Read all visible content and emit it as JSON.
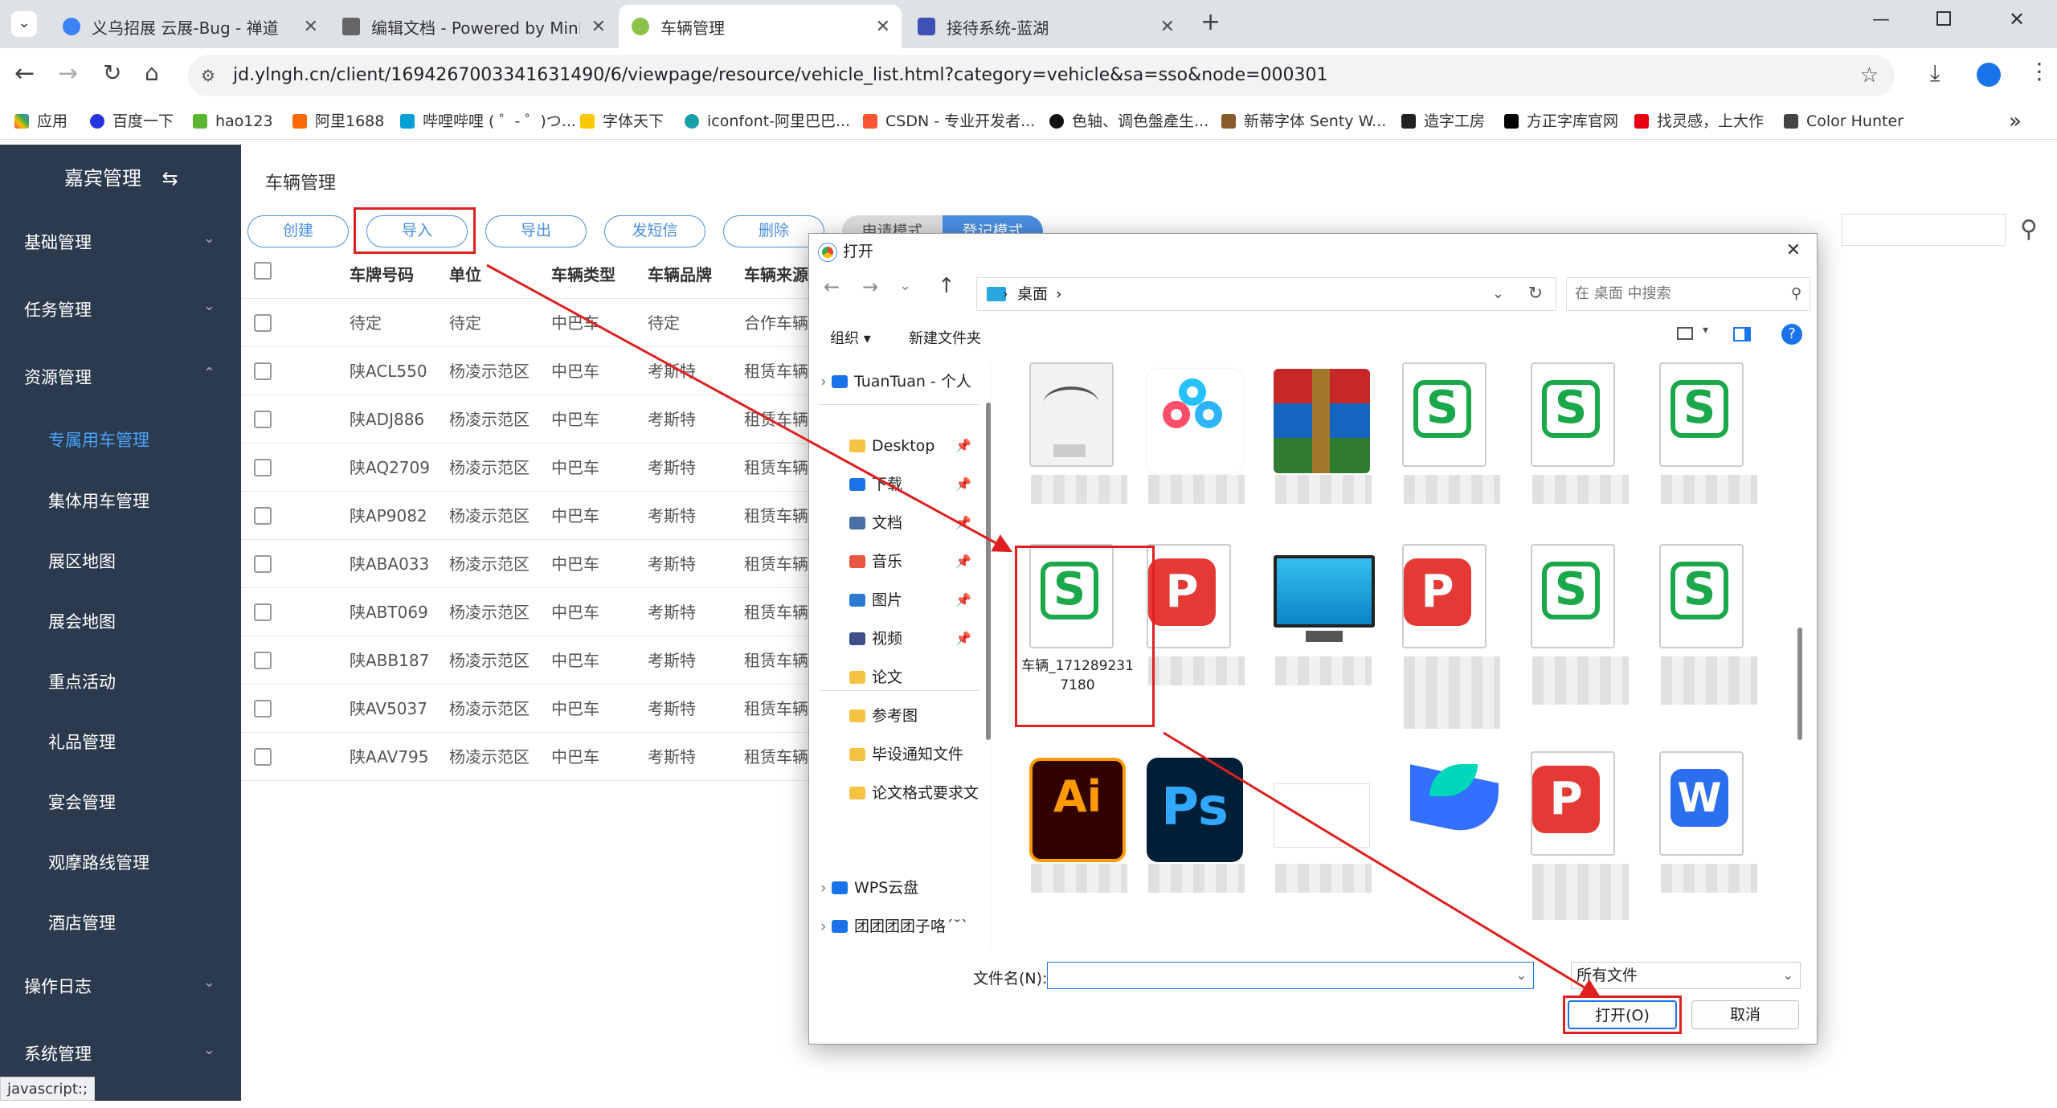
{
  "browser": {
    "tabs": [
      {
        "title": "义乌招展 云展-Bug - 禅道",
        "active": false
      },
      {
        "title": "编辑文档 - Powered by MinD",
        "active": false
      },
      {
        "title": "车辆管理",
        "active": true
      },
      {
        "title": "接待系统-蓝湖",
        "active": false
      }
    ],
    "new_tab": "+",
    "url": "jd.ylngh.cn/client/1694267003341631490/6/viewpage/resource/vehicle_list.html?category=vehicle&sa=sso&node=000301",
    "bookmarks": [
      "应用",
      "百度一下",
      "hao123",
      "阿里1688",
      "哔哩哔哩 ( ゜- ゜)つ...",
      "字体天下",
      "iconfont-阿里巴巴...",
      "CSDN - 专业开发者...",
      "色轴、调色盤產生...",
      "新蒂字体 Senty W...",
      "造字工房",
      "方正字库官网",
      "找灵感，上大作",
      "Color Hunter"
    ],
    "more": "»"
  },
  "sidebar": {
    "title": "嘉宾管理",
    "items": [
      {
        "label": "基础管理",
        "type": "group",
        "arrow": "⌄"
      },
      {
        "label": "任务管理",
        "type": "group",
        "arrow": "⌄"
      },
      {
        "label": "资源管理",
        "type": "group",
        "arrow": "⌃"
      },
      {
        "label": "专属用车管理",
        "type": "sub",
        "active": true
      },
      {
        "label": "集体用车管理",
        "type": "sub"
      },
      {
        "label": "展区地图",
        "type": "sub"
      },
      {
        "label": "展会地图",
        "type": "sub"
      },
      {
        "label": "重点活动",
        "type": "sub"
      },
      {
        "label": "礼品管理",
        "type": "sub"
      },
      {
        "label": "宴会管理",
        "type": "sub"
      },
      {
        "label": "观摩路线管理",
        "type": "sub"
      },
      {
        "label": "酒店管理",
        "type": "sub"
      },
      {
        "label": "操作日志",
        "type": "group",
        "arrow": "⌄"
      },
      {
        "label": "系统管理",
        "type": "group",
        "arrow": "⌄"
      }
    ]
  },
  "status_bar": "javascript:;",
  "page": {
    "title": "车辆管理",
    "buttons": [
      "创建",
      "导入",
      "导出",
      "发短信",
      "删除"
    ],
    "mode_tabs": [
      "申请模式",
      "登记模式"
    ],
    "table": {
      "headers": [
        "车牌号码",
        "单位",
        "车辆类型",
        "车辆品牌",
        "车辆来源"
      ],
      "rows": [
        [
          "待定",
          "待定",
          "中巴车",
          "待定",
          "合作车辆"
        ],
        [
          "陕ACL550",
          "杨凌示范区",
          "中巴车",
          "考斯特",
          "租赁车辆"
        ],
        [
          "陕ADJ886",
          "杨凌示范区",
          "中巴车",
          "考斯特",
          "租赁车辆"
        ],
        [
          "陕AQ2709",
          "杨凌示范区",
          "中巴车",
          "考斯特",
          "租赁车辆"
        ],
        [
          "陕AP9082",
          "杨凌示范区",
          "中巴车",
          "考斯特",
          "租赁车辆"
        ],
        [
          "陕ABA033",
          "杨凌示范区",
          "中巴车",
          "考斯特",
          "租赁车辆"
        ],
        [
          "陕ABT069",
          "杨凌示范区",
          "中巴车",
          "考斯特",
          "租赁车辆"
        ],
        [
          "陕ABB187",
          "杨凌示范区",
          "中巴车",
          "考斯特",
          "租赁车辆"
        ],
        [
          "陕AV5037",
          "杨凌示范区",
          "中巴车",
          "考斯特",
          "租赁车辆"
        ],
        [
          "陕AAV795",
          "杨凌示范区",
          "中巴车",
          "考斯特",
          "租赁车辆"
        ]
      ]
    }
  },
  "dialog": {
    "title": "打开",
    "close": "✕",
    "path": [
      "桌面"
    ],
    "search_placeholder": "在 桌面 中搜索",
    "organize": "组织 ▾",
    "new_folder": "新建文件夹",
    "nav": [
      {
        "label": "TuanTuan - 个人",
        "kind": "cloud"
      },
      {
        "label": "Desktop",
        "kind": "folder",
        "pinned": true
      },
      {
        "label": "下载",
        "kind": "download",
        "pinned": true
      },
      {
        "label": "文档",
        "kind": "doc",
        "pinned": true
      },
      {
        "label": "音乐",
        "kind": "music",
        "pinned": true
      },
      {
        "label": "图片",
        "kind": "pic",
        "pinned": true
      },
      {
        "label": "视频",
        "kind": "video",
        "pinned": true
      },
      {
        "label": "论文",
        "kind": "folder"
      },
      {
        "label": "参考图",
        "kind": "folder"
      },
      {
        "label": "毕设通知文件",
        "kind": "folder"
      },
      {
        "label": "论文格式要求文件",
        "kind": "folder"
      },
      {
        "label": "WPS云盘",
        "kind": "cloud"
      },
      {
        "label": "团团团团子咯ˊ˘ˋ",
        "kind": "cloud"
      }
    ],
    "selected_file": "车辆_1712892317180",
    "filename_label": "文件名(N):",
    "filename_value": "",
    "filetype": "所有文件",
    "open_button": "打开(O)",
    "cancel_button": "取消"
  },
  "colors": {
    "sidebar": "#2b3a4d",
    "accent": "#4a90e2",
    "highlight": "#e02020",
    "sidebar_active": "#4aa3ff"
  }
}
